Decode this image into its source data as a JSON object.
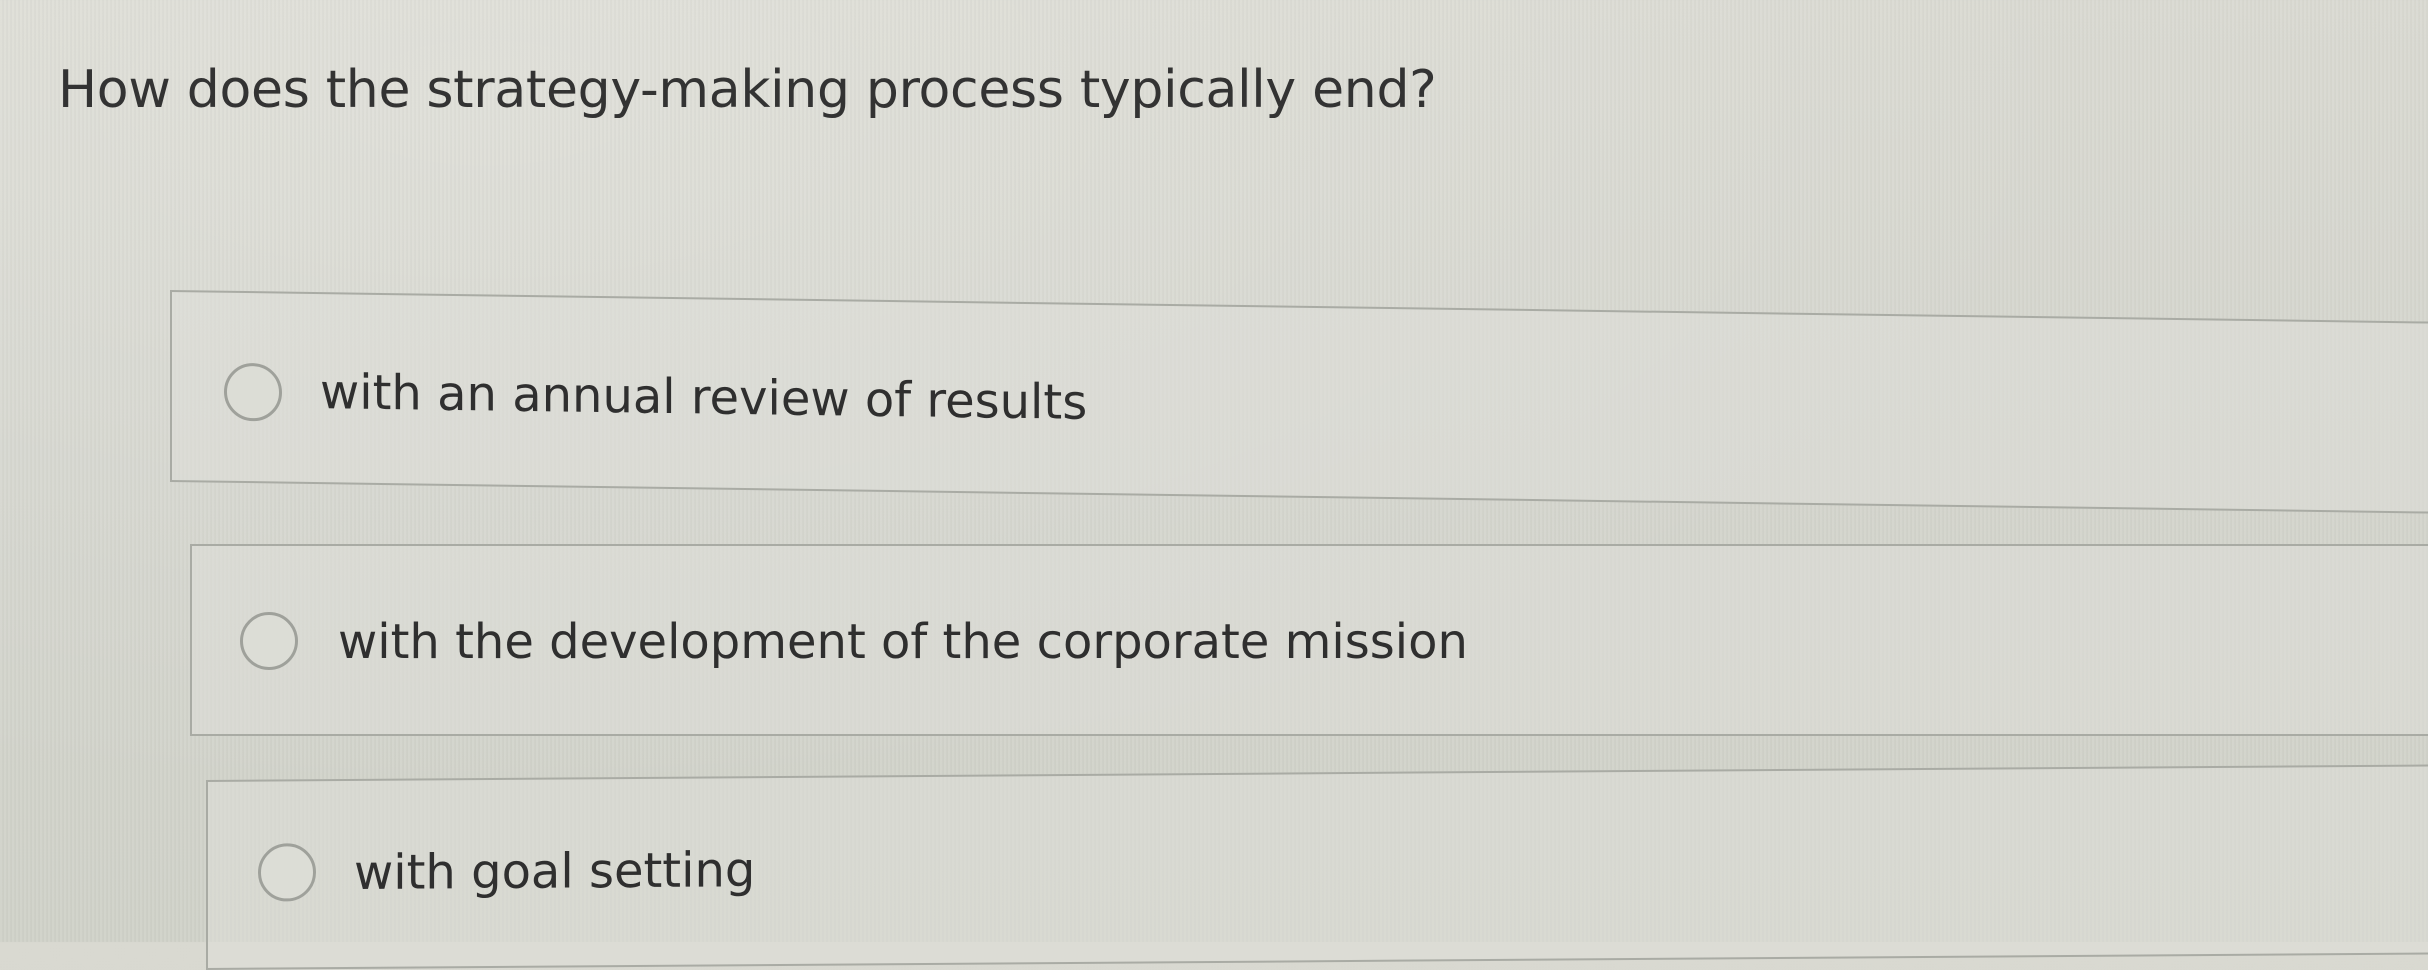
{
  "question": {
    "text": "How does the strategy-making process typically end?"
  },
  "options": [
    {
      "label": "with an annual review of results",
      "selected": false
    },
    {
      "label": "with the development of the corporate mission",
      "selected": false
    },
    {
      "label": "with goal setting",
      "selected": false
    }
  ]
}
